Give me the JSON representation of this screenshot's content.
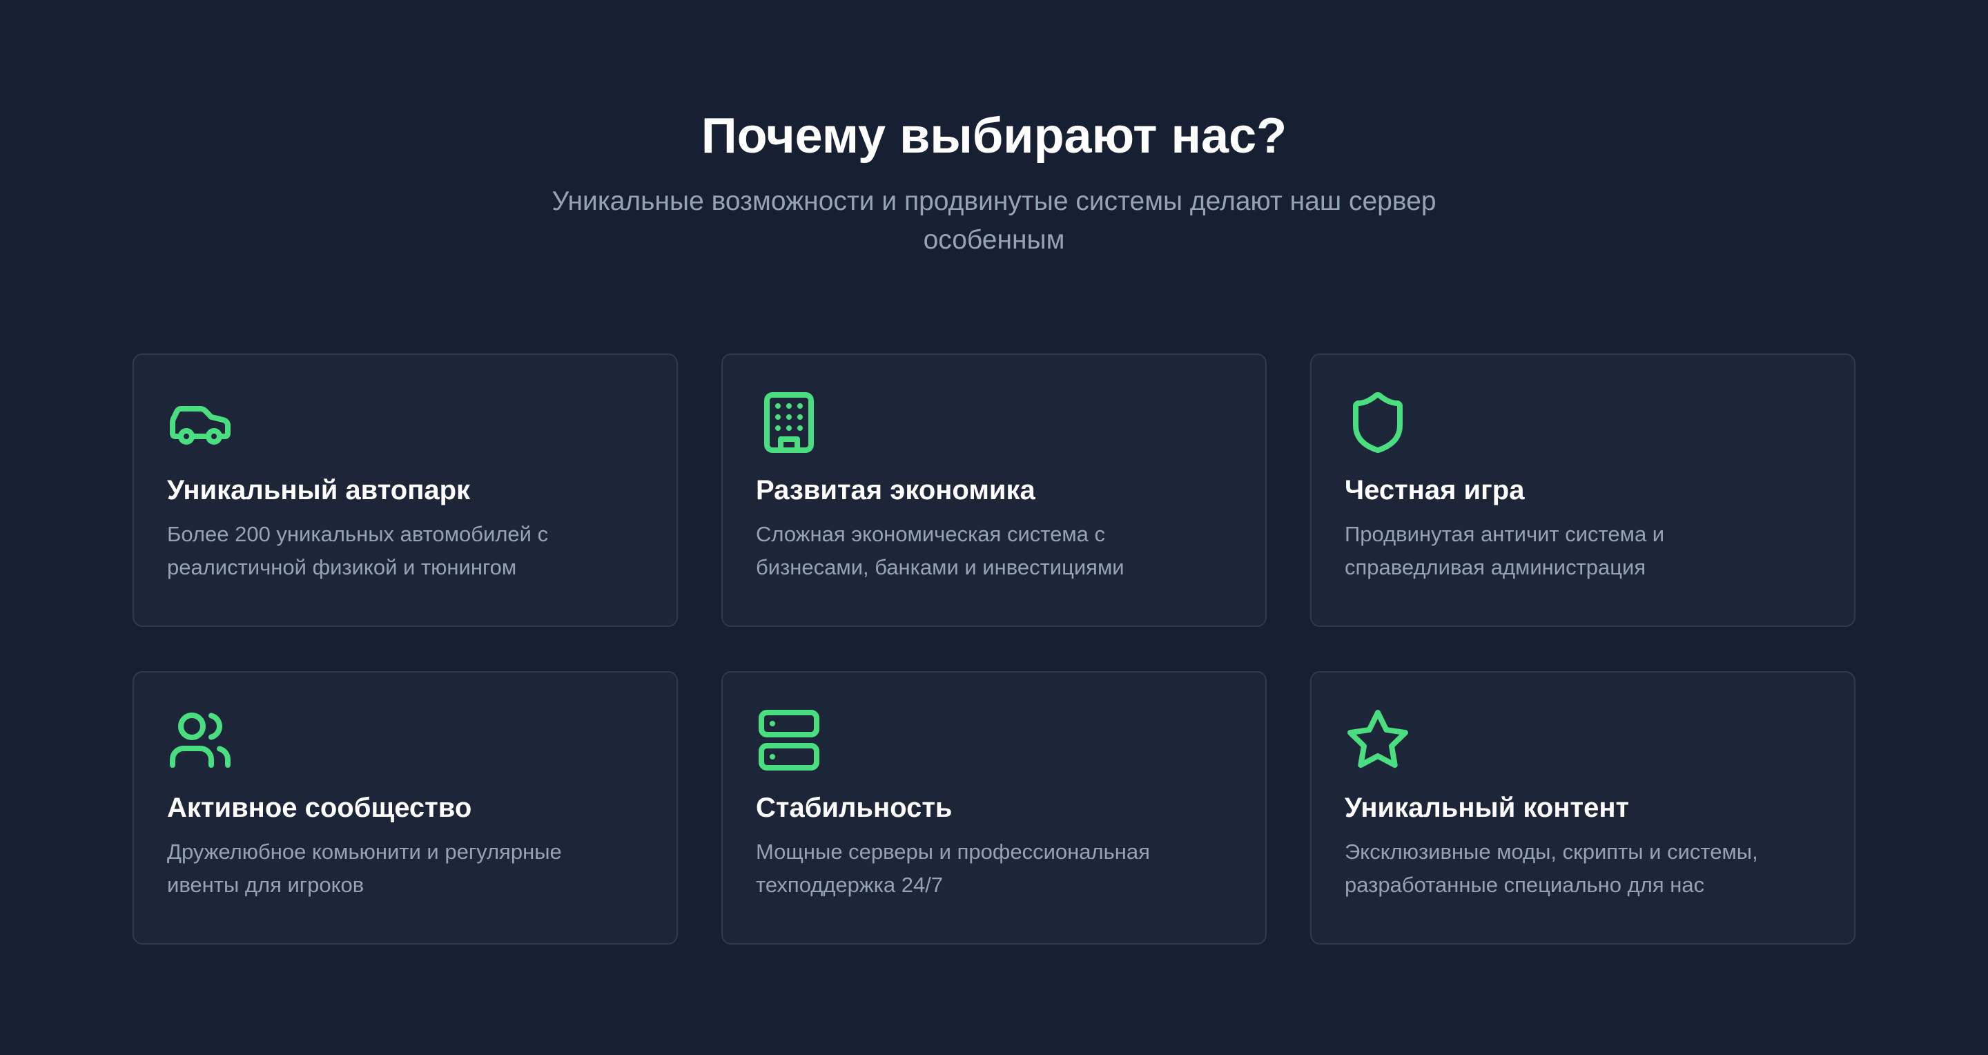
{
  "header": {
    "title": "Почему выбирают нас?",
    "subtitle": "Уникальные возможности и продвинутые системы делают наш сервер особенным"
  },
  "theme": {
    "background": "#172033",
    "card_background": "#1c2638",
    "card_border": "#2e3a4e",
    "accent": "#4ade80",
    "title_color": "#ffffff",
    "text_muted": "#94a3b8"
  },
  "features": [
    {
      "icon": "car-icon",
      "title": "Уникальный автопарк",
      "description": "Более 200 уникальных автомобилей с реалистичной физикой и тюнингом"
    },
    {
      "icon": "building-icon",
      "title": "Развитая экономика",
      "description": "Сложная экономическая система с бизнесами, банками и инвестициями"
    },
    {
      "icon": "shield-icon",
      "title": "Честная игра",
      "description": "Продвинутая античит система и справедливая администрация"
    },
    {
      "icon": "users-icon",
      "title": "Активное сообщество",
      "description": "Дружелюбное комьюнити и регулярные ивенты для игроков"
    },
    {
      "icon": "server-icon",
      "title": "Стабильность",
      "description": "Мощные серверы и профессиональная техподдержка 24/7"
    },
    {
      "icon": "star-icon",
      "title": "Уникальный контент",
      "description": "Эксклюзивные моды, скрипты и системы, разработанные специально для нас"
    }
  ]
}
